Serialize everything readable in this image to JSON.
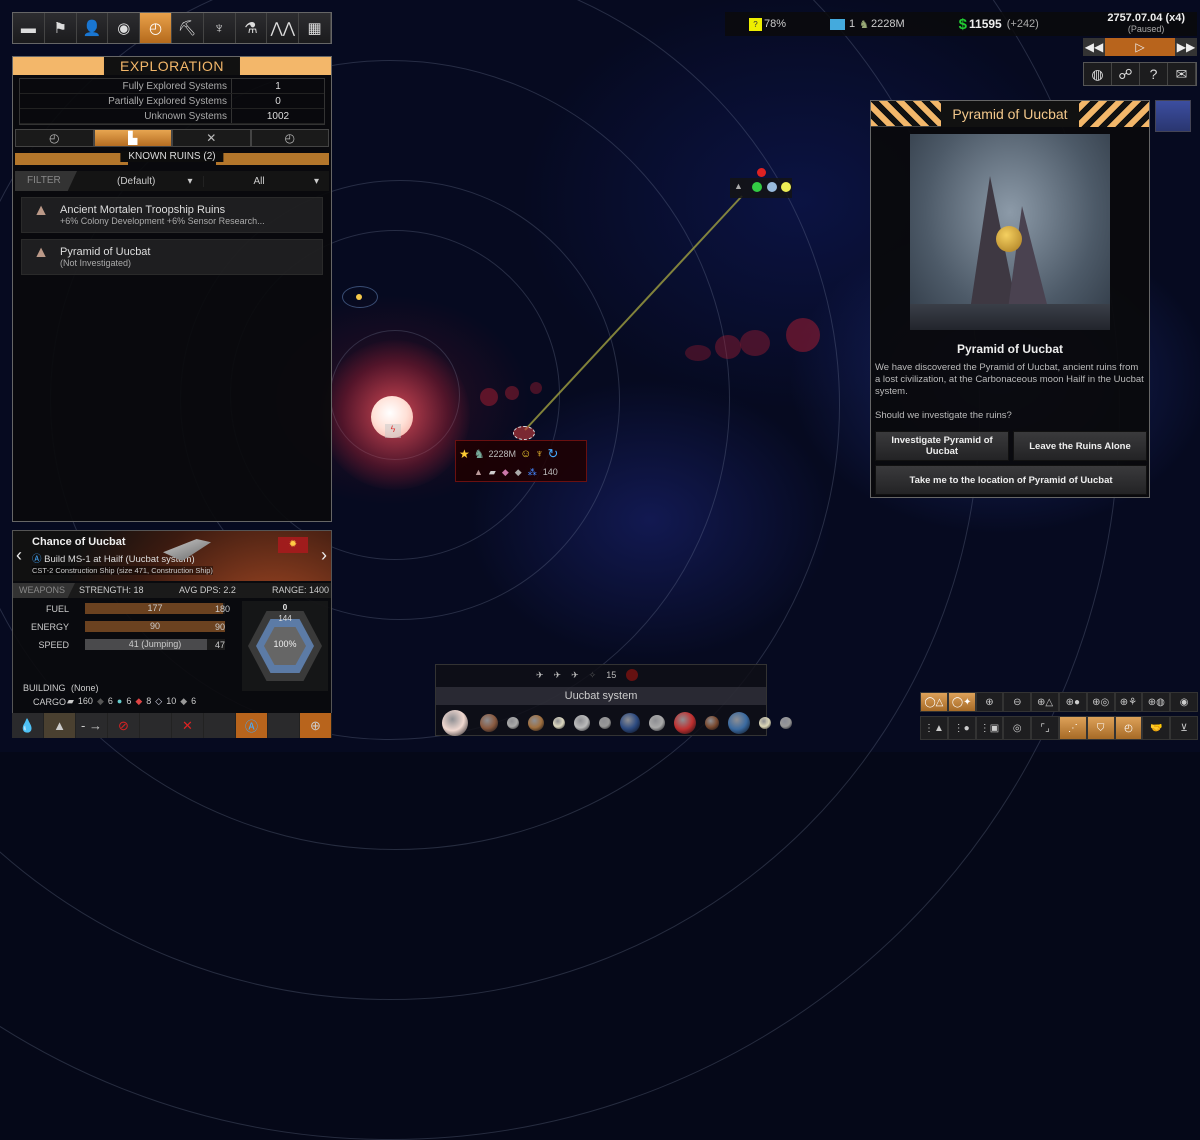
{
  "top_tabs": [
    {
      "name": "empire-flag",
      "glyph": "▬"
    },
    {
      "name": "diplomacy",
      "glyph": "⚑"
    },
    {
      "name": "characters",
      "glyph": "👤"
    },
    {
      "name": "colonies",
      "glyph": "◉"
    },
    {
      "name": "exploration",
      "glyph": "◴",
      "active": true
    },
    {
      "name": "mining",
      "glyph": "⛏"
    },
    {
      "name": "construction",
      "glyph": "♆"
    },
    {
      "name": "research",
      "glyph": "⚗"
    },
    {
      "name": "fleets",
      "glyph": "⋀⋀"
    },
    {
      "name": "expansion",
      "glyph": "▦"
    }
  ],
  "exploration": {
    "title": "EXPLORATION",
    "stats": [
      {
        "label": "Fully Explored Systems",
        "value": "1"
      },
      {
        "label": "Partially Explored Systems",
        "value": "0"
      },
      {
        "label": "Unknown Systems",
        "value": "1002"
      }
    ],
    "subtabs": [
      {
        "name": "systems",
        "glyph": "◴"
      },
      {
        "name": "ruins",
        "glyph": "▙",
        "active": true
      },
      {
        "name": "scrap",
        "glyph": "✕"
      },
      {
        "name": "locations",
        "glyph": "◴"
      }
    ],
    "list_title": "KNOWN RUINS (2)",
    "filter_label": "FILTER",
    "filter_sort": "(Default)",
    "filter_type": "All",
    "ruins": [
      {
        "name": "Ancient Mortalen Troopship Ruins",
        "detail": "+6% Colony Development  +6% Sensor Research..."
      },
      {
        "name": "Pyramid of Uucbat",
        "detail": "(Not Investigated)"
      }
    ]
  },
  "topbar": {
    "approval": "78%",
    "colonies": "1",
    "population": "2228M",
    "credits": "11595",
    "income": "(+242)",
    "date": "2757.07.04 (x4)",
    "status": "(Paused)"
  },
  "speed_controls": {
    "slower": "◀◀",
    "play": "▷",
    "faster": "▶▶"
  },
  "side_buttons": [
    {
      "name": "empires",
      "glyph": "◍"
    },
    {
      "name": "relations",
      "glyph": "☍"
    },
    {
      "name": "help",
      "glyph": "?"
    },
    {
      "name": "messages",
      "glyph": "✉"
    }
  ],
  "popup": {
    "title": "Pyramid of Uucbat",
    "heading": "Pyramid of Uucbat",
    "body": "We have discovered the Pyramid of Uucbat, ancient ruins from a lost civilization, at the Carbonaceous moon Hailf in the Uucbat system.",
    "question": "Should we investigate the ruins?",
    "btn_investigate": "Investigate Pyramid of Uucbat",
    "btn_leave": "Leave the Ruins Alone",
    "btn_goto": "Take me to the location of Pyramid of Uucbat"
  },
  "ship": {
    "name": "Chance of Uucbat",
    "mission": "Build MS-1 at Hailf (Uucbat system)",
    "design": "CST-2 Construction Ship (size 471, Construction Ship)",
    "weapons_label": "WEAPONS",
    "strength": "STRENGTH: 18",
    "dps": "AVG DPS: 2.2",
    "range": "RANGE: 1400",
    "fuel": {
      "label": "FUEL",
      "value": "177",
      "max": "180",
      "fraction": 0.983
    },
    "energy": {
      "label": "ENERGY",
      "value": "90",
      "max": "90",
      "fraction": 1.0
    },
    "speed": {
      "label": "SPEED",
      "value": "41 (Jumping)",
      "max": "47",
      "fraction": 0.872
    },
    "shields": "0",
    "armor": "144",
    "hull": "100%",
    "building_label": "BUILDING",
    "building": "(None)",
    "cargo_label": "CARGO",
    "cargo": [
      {
        "name": "steel",
        "glyph": "▰",
        "qty": "160"
      },
      {
        "name": "carbon",
        "glyph": "◆",
        "qty": "6"
      },
      {
        "name": "ice",
        "glyph": "●",
        "qty": "6"
      },
      {
        "name": "ore",
        "glyph": "◆",
        "qty": "8"
      },
      {
        "name": "crystal",
        "glyph": "◇",
        "qty": "10"
      },
      {
        "name": "rock",
        "glyph": "◆",
        "qty": "6"
      }
    ]
  },
  "ship_actions": [
    {
      "name": "refuel",
      "glyph": "💧"
    },
    {
      "name": "move",
      "glyph": "▲"
    },
    {
      "name": "waypoint",
      "glyph": "- →"
    },
    {
      "name": "cancel",
      "glyph": "⊘"
    },
    {
      "name": "empty1",
      "glyph": ""
    },
    {
      "name": "scrap",
      "glyph": "✕"
    },
    {
      "name": "empty2",
      "glyph": ""
    },
    {
      "name": "automate",
      "glyph": "Ⓐ"
    },
    {
      "name": "empty3",
      "glyph": ""
    },
    {
      "name": "focus",
      "glyph": "⊕"
    }
  ],
  "system": {
    "name": "Uucbat system",
    "ship_count": "15"
  },
  "fleet_label": {
    "population": "2228M",
    "troops": "140"
  },
  "map_tools_row1": [
    "◯△",
    "◯✦",
    "⊕",
    "⊖",
    "⊕△",
    "⊕●",
    "⊕◎",
    "⊕⚘",
    "⊕◍",
    "◉"
  ],
  "map_tools_row2": [
    "⋮▲",
    "⋮●",
    "⋮▣",
    "◎",
    "⌜⌟",
    "⋰",
    "⛉",
    "◴",
    "🤝",
    "⊻"
  ]
}
